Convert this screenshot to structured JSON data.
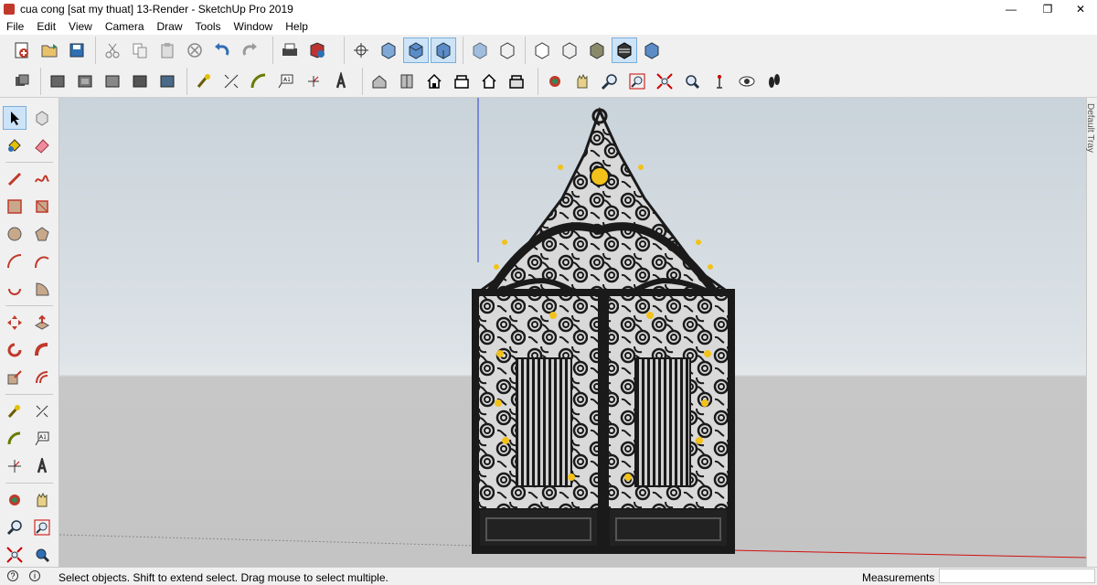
{
  "window": {
    "title": "cua cong [sat my thuat] 13-Render - SketchUp Pro 2019",
    "minimize": "—",
    "restore": "❐",
    "close": "✕"
  },
  "menu": [
    "File",
    "Edit",
    "View",
    "Camera",
    "Draw",
    "Tools",
    "Window",
    "Help"
  ],
  "toolbar_icons": {
    "row1": [
      "new-icon",
      "open-icon",
      "save-icon",
      "cut-icon",
      "copy-icon",
      "paste-icon",
      "erase-icon",
      "undo-icon",
      "redo-icon",
      "print-icon",
      "model-info-icon",
      "orbit-icon",
      "iso-view-icon",
      "top-view-icon",
      "front-view-icon",
      "xray-icon",
      "wireframe-icon",
      "hidden-line-icon",
      "shaded-icon",
      "shaded-textures-icon",
      "monochrome-icon"
    ],
    "row2": [
      "components-icon",
      "group-icon",
      "dynamic-component-icon",
      "interact-icon",
      "options-icon",
      "tape-measure-icon",
      "dimension-icon",
      "protractor-icon",
      "text-icon",
      "axes-icon",
      "3d-text-icon",
      "iso-house-icon",
      "front-house-icon",
      "home-icon",
      "back-house-icon",
      "outline-house-icon",
      "left-house-icon",
      "orbit-icon",
      "pan-icon",
      "zoom-icon",
      "zoom-window-icon",
      "zoom-extents-icon",
      "previous-view-icon",
      "position-camera-icon",
      "look-around-icon",
      "walk-icon"
    ]
  },
  "side_tray": {
    "label": "Default Tray"
  },
  "status": {
    "message": "Select objects. Shift to extend select. Drag mouse to select multiple.",
    "measurements_label": "Measurements",
    "measurements_value": ""
  },
  "colors": {
    "sky": "#c9d3da",
    "ground": "#c4c4c4",
    "gate_iron": "#1a1a1a",
    "gold": "#f2c21b",
    "selection": "#cde3f7"
  }
}
